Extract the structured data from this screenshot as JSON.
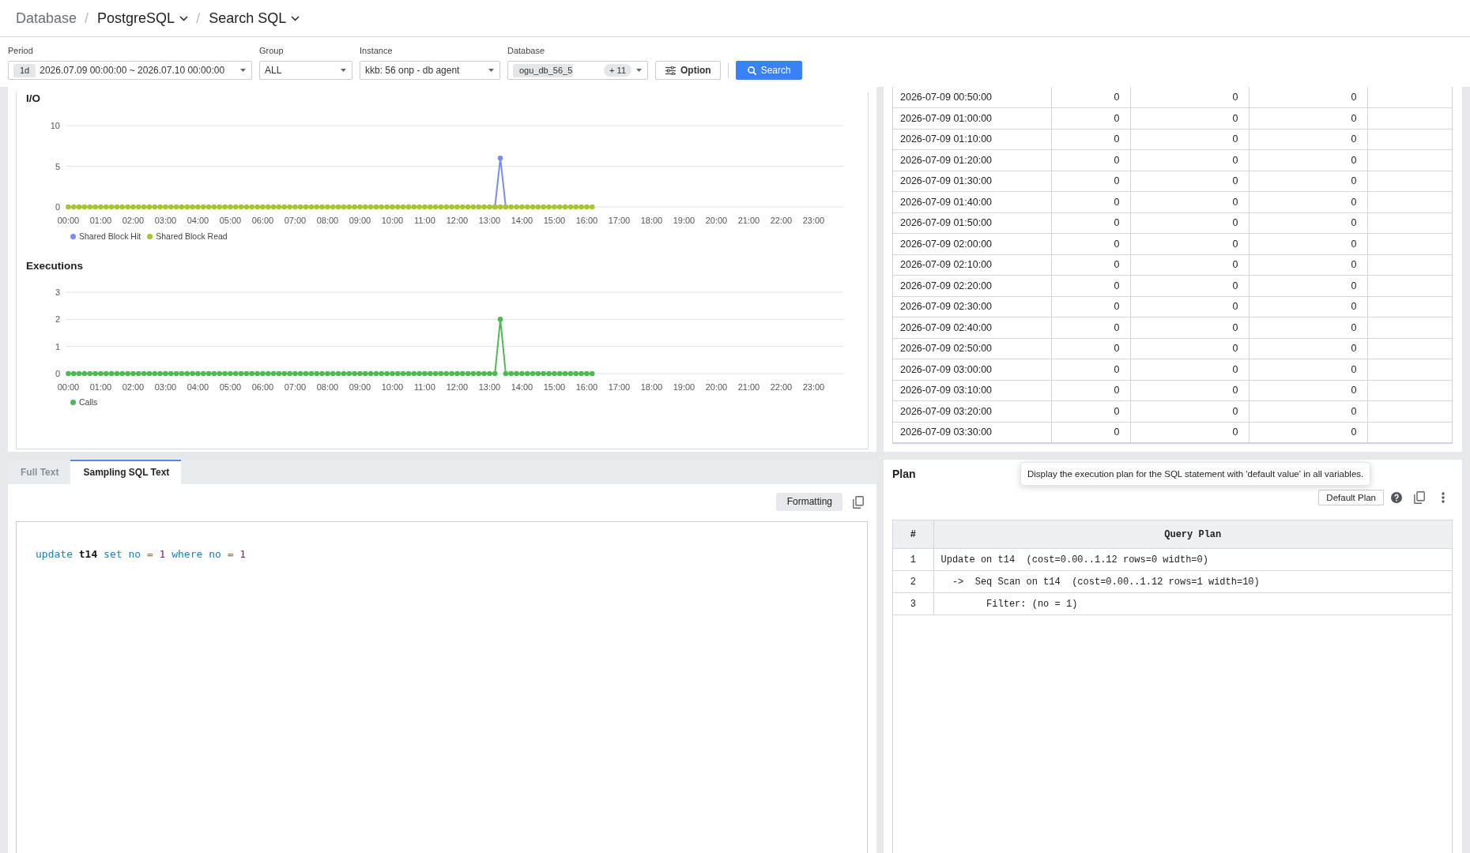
{
  "breadcrumb": [
    {
      "kind": "link",
      "label": "Database"
    },
    {
      "kind": "dropdown",
      "separator": "/",
      "label": "PostgreSQL"
    },
    {
      "kind": "dropdown",
      "separator": "/",
      "label": "Search SQL"
    }
  ],
  "filters": [
    {
      "kind": "period",
      "label": "Period",
      "unit": "1d",
      "value": "2026.07.09 00:00:00 ~ 2026.07.10 00:00:00"
    },
    {
      "kind": "select",
      "label": "Group",
      "value": "ALL"
    },
    {
      "kind": "select",
      "label": "Instance",
      "value": "kkb: 56 onp - db agent"
    },
    {
      "kind": "multiselect",
      "label": "Database",
      "tag": "ogu_db_56_5",
      "more": "+ 11"
    }
  ],
  "buttons": [
    {
      "kind": "secondary",
      "label": "Option"
    },
    {
      "kind": "primary",
      "label": "Search"
    }
  ],
  "charts": [
    {
      "title": "I/O",
      "chart_data": {
        "type": "line",
        "x": [
          0,
          10,
          20,
          30,
          40,
          50,
          60,
          70,
          80,
          90,
          100,
          110,
          120,
          130,
          140,
          150,
          160,
          170,
          180,
          190,
          200,
          210,
          220,
          230,
          240,
          250,
          260,
          270,
          280,
          290,
          300,
          310,
          320,
          330,
          340,
          350,
          360,
          370,
          380,
          390,
          400,
          410,
          420,
          430,
          440,
          450,
          460,
          470,
          480,
          490,
          500,
          510,
          520,
          530,
          540,
          550,
          560,
          570,
          580,
          590,
          600,
          610,
          620,
          630,
          640,
          650,
          660,
          670,
          680,
          690,
          700,
          710,
          720,
          730,
          740,
          750,
          760,
          770,
          780,
          790,
          800,
          810,
          820,
          830,
          840,
          850,
          860,
          870,
          880,
          890,
          900,
          910,
          920,
          930,
          940,
          950,
          960,
          970
        ],
        "xlim": [
          -5,
          1435
        ],
        "ylim": [
          0,
          10
        ],
        "xticks": [
          {
            "value": 0,
            "label": "00:00"
          },
          {
            "value": 60,
            "label": "01:00"
          },
          {
            "value": 120,
            "label": "02:00"
          },
          {
            "value": 180,
            "label": "03:00"
          },
          {
            "value": 240,
            "label": "04:00"
          },
          {
            "value": 300,
            "label": "05:00"
          },
          {
            "value": 360,
            "label": "06:00"
          },
          {
            "value": 420,
            "label": "07:00"
          },
          {
            "value": 480,
            "label": "08:00"
          },
          {
            "value": 540,
            "label": "09:00"
          },
          {
            "value": 600,
            "label": "10:00"
          },
          {
            "value": 660,
            "label": "11:00"
          },
          {
            "value": 720,
            "label": "12:00"
          },
          {
            "value": 780,
            "label": "13:00"
          },
          {
            "value": 840,
            "label": "14:00"
          },
          {
            "value": 900,
            "label": "15:00"
          },
          {
            "value": 960,
            "label": "16:00"
          },
          {
            "value": 1020,
            "label": "17:00"
          },
          {
            "value": 1080,
            "label": "18:00"
          },
          {
            "value": 1140,
            "label": "19:00"
          },
          {
            "value": 1200,
            "label": "20:00"
          },
          {
            "value": 1260,
            "label": "21:00"
          },
          {
            "value": 1320,
            "label": "22:00"
          },
          {
            "value": 1380,
            "label": "23:00"
          }
        ],
        "yticks": [
          0,
          5,
          10
        ],
        "series": [
          {
            "name": "Shared Block Hit",
            "color": "#7b8cf2",
            "marker": "circle",
            "values": [
              null,
              null,
              null,
              null,
              null,
              null,
              null,
              null,
              null,
              null,
              null,
              null,
              null,
              null,
              null,
              null,
              null,
              null,
              null,
              null,
              null,
              null,
              null,
              null,
              null,
              null,
              null,
              null,
              null,
              null,
              null,
              null,
              null,
              null,
              null,
              null,
              null,
              null,
              null,
              null,
              null,
              null,
              null,
              null,
              null,
              null,
              null,
              null,
              null,
              null,
              null,
              null,
              null,
              null,
              null,
              null,
              null,
              null,
              null,
              null,
              null,
              null,
              null,
              null,
              null,
              null,
              null,
              null,
              null,
              null,
              null,
              null,
              null,
              null,
              null,
              null,
              null,
              null,
              null,
              0,
              6,
              0,
              null,
              null,
              null,
              null,
              null,
              null,
              null,
              null,
              null,
              null,
              null,
              null,
              null,
              null,
              null,
              null
            ]
          },
          {
            "name": "Shared Block Read",
            "color": "#a8c430",
            "marker": "circle",
            "values": [
              0,
              0,
              0,
              0,
              0,
              0,
              0,
              0,
              0,
              0,
              0,
              0,
              0,
              0,
              0,
              0,
              0,
              0,
              0,
              0,
              0,
              0,
              0,
              0,
              0,
              0,
              0,
              0,
              0,
              0,
              0,
              0,
              0,
              0,
              0,
              0,
              0,
              0,
              0,
              0,
              0,
              0,
              0,
              0,
              0,
              0,
              0,
              0,
              0,
              0,
              0,
              0,
              0,
              0,
              0,
              0,
              0,
              0,
              0,
              0,
              0,
              0,
              0,
              0,
              0,
              0,
              0,
              0,
              0,
              0,
              0,
              0,
              0,
              0,
              0,
              0,
              0,
              0,
              0,
              0,
              0,
              0,
              0,
              0,
              0,
              0,
              0,
              0,
              0,
              0,
              0,
              0,
              0,
              0,
              0,
              0,
              0,
              0
            ]
          }
        ]
      }
    },
    {
      "title": "Executions",
      "chart_data": {
        "type": "line",
        "x": [
          0,
          10,
          20,
          30,
          40,
          50,
          60,
          70,
          80,
          90,
          100,
          110,
          120,
          130,
          140,
          150,
          160,
          170,
          180,
          190,
          200,
          210,
          220,
          230,
          240,
          250,
          260,
          270,
          280,
          290,
          300,
          310,
          320,
          330,
          340,
          350,
          360,
          370,
          380,
          390,
          400,
          410,
          420,
          430,
          440,
          450,
          460,
          470,
          480,
          490,
          500,
          510,
          520,
          530,
          540,
          550,
          560,
          570,
          580,
          590,
          600,
          610,
          620,
          630,
          640,
          650,
          660,
          670,
          680,
          690,
          700,
          710,
          720,
          730,
          740,
          750,
          760,
          770,
          780,
          790,
          800,
          810,
          820,
          830,
          840,
          850,
          860,
          870,
          880,
          890,
          900,
          910,
          920,
          930,
          940,
          950,
          960,
          970
        ],
        "xlim": [
          -5,
          1435
        ],
        "ylim": [
          0,
          3
        ],
        "xticks": [
          {
            "value": 0,
            "label": "00:00"
          },
          {
            "value": 60,
            "label": "01:00"
          },
          {
            "value": 120,
            "label": "02:00"
          },
          {
            "value": 180,
            "label": "03:00"
          },
          {
            "value": 240,
            "label": "04:00"
          },
          {
            "value": 300,
            "label": "05:00"
          },
          {
            "value": 360,
            "label": "06:00"
          },
          {
            "value": 420,
            "label": "07:00"
          },
          {
            "value": 480,
            "label": "08:00"
          },
          {
            "value": 540,
            "label": "09:00"
          },
          {
            "value": 600,
            "label": "10:00"
          },
          {
            "value": 660,
            "label": "11:00"
          },
          {
            "value": 720,
            "label": "12:00"
          },
          {
            "value": 780,
            "label": "13:00"
          },
          {
            "value": 840,
            "label": "14:00"
          },
          {
            "value": 900,
            "label": "15:00"
          },
          {
            "value": 960,
            "label": "16:00"
          },
          {
            "value": 1020,
            "label": "17:00"
          },
          {
            "value": 1080,
            "label": "18:00"
          },
          {
            "value": 1140,
            "label": "19:00"
          },
          {
            "value": 1200,
            "label": "20:00"
          },
          {
            "value": 1260,
            "label": "21:00"
          },
          {
            "value": 1320,
            "label": "22:00"
          },
          {
            "value": 1380,
            "label": "23:00"
          }
        ],
        "yticks": [
          0,
          1,
          2,
          3
        ],
        "series": [
          {
            "name": "Calls",
            "color": "#4dba52",
            "marker": "circle",
            "values": [
              0,
              0,
              0,
              0,
              0,
              0,
              0,
              0,
              0,
              0,
              0,
              0,
              0,
              0,
              0,
              0,
              0,
              0,
              0,
              0,
              0,
              0,
              0,
              0,
              0,
              0,
              0,
              0,
              0,
              0,
              0,
              0,
              0,
              0,
              0,
              0,
              0,
              0,
              0,
              0,
              0,
              0,
              0,
              0,
              0,
              0,
              0,
              0,
              0,
              0,
              0,
              0,
              0,
              0,
              0,
              0,
              0,
              0,
              0,
              0,
              0,
              0,
              0,
              0,
              0,
              0,
              0,
              0,
              0,
              0,
              0,
              0,
              0,
              0,
              0,
              0,
              0,
              0,
              0,
              0,
              2,
              0,
              0,
              0,
              0,
              0,
              0,
              0,
              0,
              0,
              0,
              0,
              0,
              0,
              0,
              0,
              0,
              0
            ]
          }
        ]
      }
    }
  ],
  "metrics_table": {
    "rows": [
      {
        "cells": [
          "2026-07-09 00:50:00",
          "0",
          "0",
          "0"
        ]
      },
      {
        "cells": [
          "2026-07-09 01:00:00",
          "0",
          "0",
          "0"
        ]
      },
      {
        "cells": [
          "2026-07-09 01:10:00",
          "0",
          "0",
          "0"
        ]
      },
      {
        "cells": [
          "2026-07-09 01:20:00",
          "0",
          "0",
          "0"
        ]
      },
      {
        "cells": [
          "2026-07-09 01:30:00",
          "0",
          "0",
          "0"
        ]
      },
      {
        "cells": [
          "2026-07-09 01:40:00",
          "0",
          "0",
          "0"
        ]
      },
      {
        "cells": [
          "2026-07-09 01:50:00",
          "0",
          "0",
          "0"
        ]
      },
      {
        "cells": [
          "2026-07-09 02:00:00",
          "0",
          "0",
          "0"
        ]
      },
      {
        "cells": [
          "2026-07-09 02:10:00",
          "0",
          "0",
          "0"
        ]
      },
      {
        "cells": [
          "2026-07-09 02:20:00",
          "0",
          "0",
          "0"
        ]
      },
      {
        "cells": [
          "2026-07-09 02:30:00",
          "0",
          "0",
          "0"
        ]
      },
      {
        "cells": [
          "2026-07-09 02:40:00",
          "0",
          "0",
          "0"
        ]
      },
      {
        "cells": [
          "2026-07-09 02:50:00",
          "0",
          "0",
          "0"
        ]
      },
      {
        "cells": [
          "2026-07-09 03:00:00",
          "0",
          "0",
          "0"
        ]
      },
      {
        "cells": [
          "2026-07-09 03:10:00",
          "0",
          "0",
          "0"
        ]
      },
      {
        "cells": [
          "2026-07-09 03:20:00",
          "0",
          "0",
          "0"
        ]
      },
      {
        "cells": [
          "2026-07-09 03:30:00",
          "0",
          "0",
          "0"
        ]
      }
    ]
  },
  "sql_panel": {
    "tabs": [
      {
        "label": "Full Text",
        "selected": false
      },
      {
        "label": "Sampling SQL Text",
        "selected": true
      }
    ],
    "formatting_button": "Formatting",
    "code": [
      {
        "text": "update",
        "kind": "keyword"
      },
      {
        "text": "t14",
        "kind": "identifier"
      },
      {
        "text": "set",
        "kind": "keyword"
      },
      {
        "text": "no",
        "kind": "keyword"
      },
      {
        "text": "=",
        "kind": "operator"
      },
      {
        "text": "1",
        "kind": "number"
      },
      {
        "text": "where",
        "kind": "keyword"
      },
      {
        "text": "no",
        "kind": "keyword"
      },
      {
        "text": "=",
        "kind": "operator"
      },
      {
        "text": "1",
        "kind": "number"
      }
    ]
  },
  "plan_panel": {
    "title": "Plan",
    "tooltip": "Display the execution plan for the SQL statement with 'default value' in all variables.",
    "default_plan_button": "Default Plan",
    "table": {
      "columns": [
        "#",
        "Query Plan"
      ],
      "rows": [
        {
          "cells": [
            "1",
            "Update on t14  (cost=0.00..1.12 rows=0 width=0)"
          ]
        },
        {
          "cells": [
            "2",
            "  ->  Seq Scan on t14  (cost=0.00..1.12 rows=1 width=10)"
          ]
        },
        {
          "cells": [
            "3",
            "        Filter: (no = 1)"
          ]
        }
      ]
    }
  }
}
